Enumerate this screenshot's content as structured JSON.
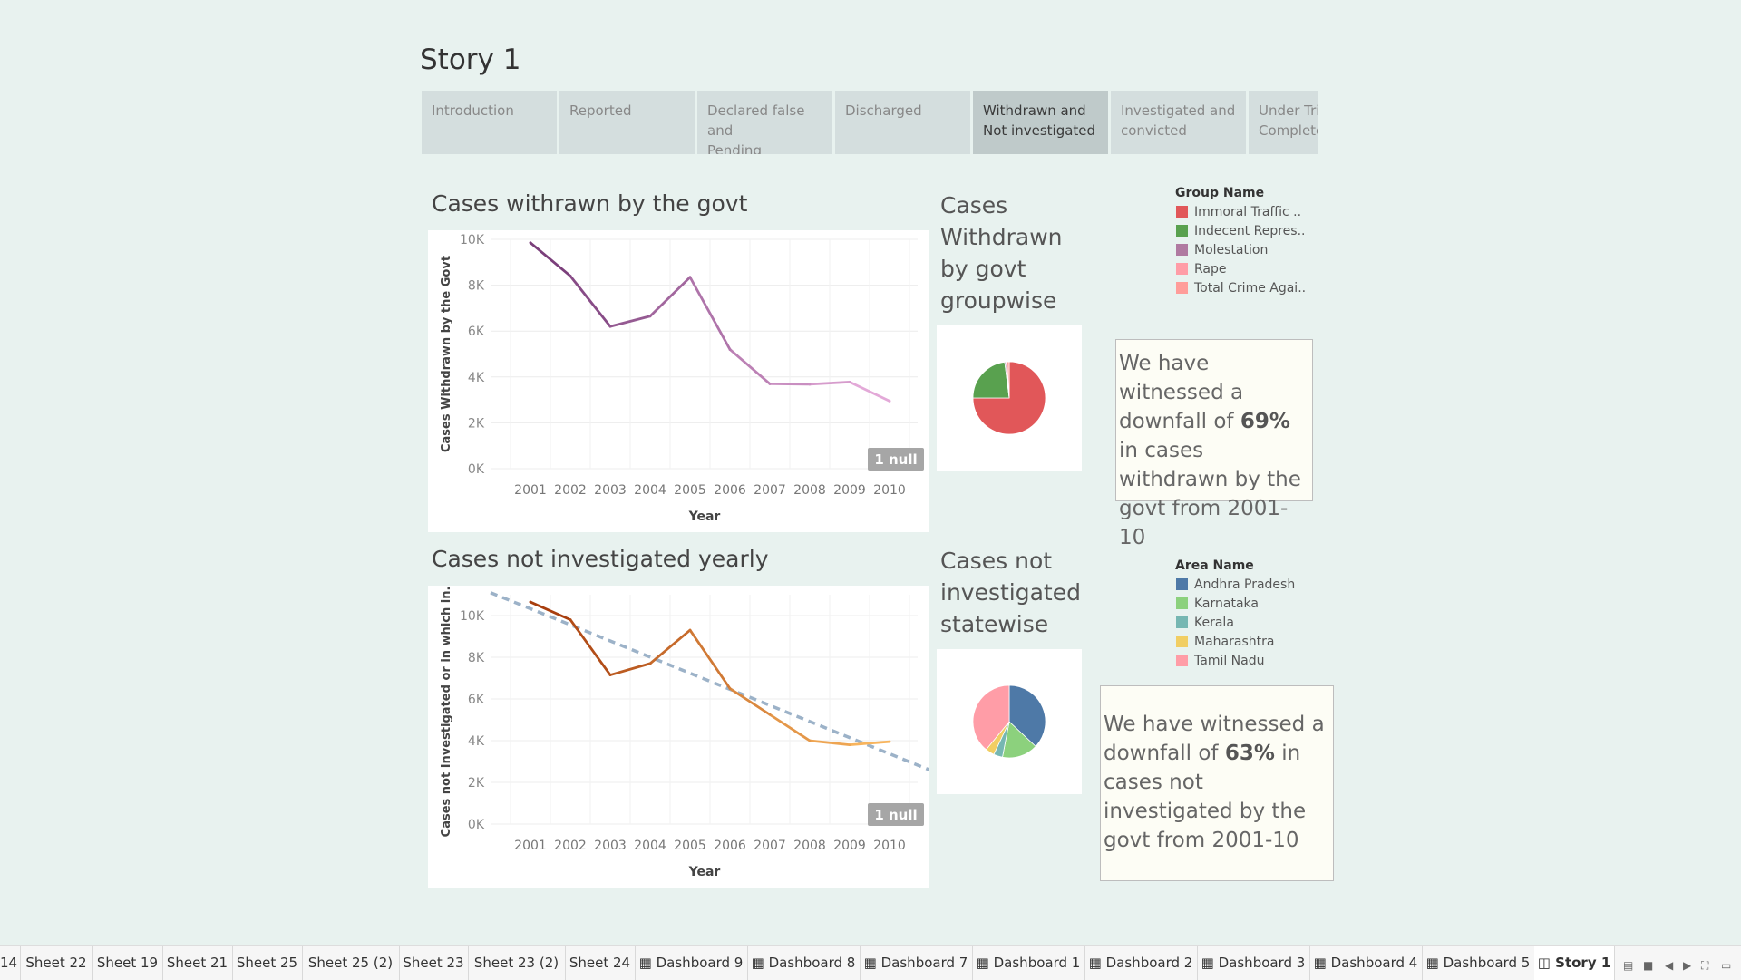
{
  "story": {
    "title": "Story 1",
    "tabs": [
      {
        "line1": "Introduction",
        "line2": ""
      },
      {
        "line1": "Reported",
        "line2": ""
      },
      {
        "line1": "Declared false and",
        "line2": "Pending"
      },
      {
        "line1": "Discharged",
        "line2": ""
      },
      {
        "line1": "Withdrawn and",
        "line2": "Not investigated"
      },
      {
        "line1": "Investigated and",
        "line2": "convicted"
      },
      {
        "line1": "Under Trial",
        "line2": "Complete"
      }
    ],
    "active_tab": 4
  },
  "chart1": {
    "title": "Cases withrawn by the govt",
    "null_badge": "1 null"
  },
  "chart2": {
    "title": "Cases not investigated yearly",
    "null_badge": "1 null"
  },
  "pie1": {
    "title_lines": [
      "Cases",
      "Withdrawn",
      "by govt",
      "groupwise"
    ],
    "legend_title": "Group Name",
    "legend": [
      {
        "label": "Immoral Traffic ..",
        "color": "#e15759"
      },
      {
        "label": "Indecent Repres..",
        "color": "#59a14f"
      },
      {
        "label": "Molestation",
        "color": "#b07aa1"
      },
      {
        "label": "Rape",
        "color": "#ff9da7"
      },
      {
        "label": "Total Crime Agai..",
        "color": "#ff9d9a"
      }
    ],
    "slices": [
      {
        "name": "Immoral Traffic ..",
        "value": 0.75,
        "color": "#e15759"
      },
      {
        "name": "Indecent Repres..",
        "value": 0.23,
        "color": "#59a14f"
      },
      {
        "name": "Molestation",
        "value": 0.006,
        "color": "#b07aa1"
      },
      {
        "name": "Rape",
        "value": 0.004,
        "color": "#ff9da7"
      },
      {
        "name": "Total Crime Agai..",
        "value": 0.01,
        "color": "#ff9d9a"
      }
    ]
  },
  "pie2": {
    "title_lines": [
      "Cases not",
      "investigated",
      "statewise"
    ],
    "legend_title": "Area Name",
    "legend": [
      {
        "label": "Andhra Pradesh",
        "color": "#4e79a7"
      },
      {
        "label": "Karnataka",
        "color": "#8cd17d"
      },
      {
        "label": "Kerala",
        "color": "#76b7b2"
      },
      {
        "label": "Maharashtra",
        "color": "#f1ce63"
      },
      {
        "label": "Tamil Nadu",
        "color": "#ff9da7"
      }
    ],
    "slices": [
      {
        "name": "Andhra Pradesh",
        "value": 0.37,
        "color": "#4e79a7"
      },
      {
        "name": "Karnataka",
        "value": 0.16,
        "color": "#8cd17d"
      },
      {
        "name": "Kerala",
        "value": 0.04,
        "color": "#76b7b2"
      },
      {
        "name": "Maharashtra",
        "value": 0.04,
        "color": "#f1ce63"
      },
      {
        "name": "Tamil Nadu",
        "value": 0.39,
        "color": "#ff9da7"
      }
    ]
  },
  "note1": {
    "pre": "We have witnessed a downfall of ",
    "pct": "69%",
    "post": " in cases withdrawn by the govt from 2001-10"
  },
  "note2": {
    "pre": "We have witnessed a downfall of ",
    "pct": "63%",
    "post": " in cases not investigated by the govt from 2001-10"
  },
  "bottom_tabs": [
    {
      "label": "14",
      "icon": ""
    },
    {
      "label": "Sheet 22",
      "icon": ""
    },
    {
      "label": "Sheet 19",
      "icon": ""
    },
    {
      "label": "Sheet 21",
      "icon": ""
    },
    {
      "label": "Sheet 25",
      "icon": ""
    },
    {
      "label": "Sheet 25 (2)",
      "icon": ""
    },
    {
      "label": "Sheet 23",
      "icon": ""
    },
    {
      "label": "Sheet 23 (2)",
      "icon": ""
    },
    {
      "label": "Sheet 24",
      "icon": ""
    },
    {
      "label": "Dashboard 9",
      "icon": "dashboard-icon"
    },
    {
      "label": "Dashboard 8",
      "icon": "dashboard-icon"
    },
    {
      "label": "Dashboard 7",
      "icon": "dashboard-icon"
    },
    {
      "label": "Dashboard 1",
      "icon": "dashboard-icon"
    },
    {
      "label": "Dashboard 2",
      "icon": "dashboard-icon"
    },
    {
      "label": "Dashboard 3",
      "icon": "dashboard-icon"
    },
    {
      "label": "Dashboard 4",
      "icon": "dashboard-icon"
    },
    {
      "label": "Dashboard 5",
      "icon": "dashboard-icon"
    },
    {
      "label": "Story 1",
      "icon": "story-icon"
    }
  ],
  "chart_data": [
    {
      "type": "line",
      "title": "Cases withrawn by the govt",
      "xlabel": "Year",
      "ylabel": "Cases Withdrawn by the Govt",
      "x": [
        "2001",
        "2002",
        "2003",
        "2004",
        "2005",
        "2006",
        "2007",
        "2008",
        "2009",
        "2010"
      ],
      "series": [
        {
          "values": [
            9850,
            8400,
            6200,
            6650,
            8350,
            5200,
            3700,
            3680,
            3780,
            2950
          ]
        }
      ],
      "ylim": [
        0,
        10000
      ],
      "yticks": [
        "0K",
        "2K",
        "4K",
        "6K",
        "8K",
        "10K"
      ],
      "color_gradient": [
        "#7b3f7b",
        "#e3a9d8"
      ],
      "grid": true
    },
    {
      "type": "line",
      "title": "Cases not investigated yearly",
      "xlabel": "Year",
      "ylabel": "Cases not Investigated or in which in..",
      "x": [
        "2001",
        "2002",
        "2003",
        "2004",
        "2005",
        "2006",
        "2007",
        "2008",
        "2009",
        "2010"
      ],
      "series": [
        {
          "values": [
            10650,
            9800,
            7150,
            7700,
            9300,
            6500,
            5250,
            4000,
            3800,
            3950
          ]
        }
      ],
      "trendline": {
        "start": [
          2000.0,
          11100
        ],
        "end": [
          2011.0,
          2600
        ]
      },
      "ylim": [
        0,
        11000
      ],
      "yticks": [
        "0K",
        "2K",
        "4K",
        "6K",
        "8K",
        "10K"
      ],
      "color_gradient": [
        "#a83e0e",
        "#f8b45c"
      ],
      "trend_color": "#9cb2c8",
      "grid": true
    }
  ]
}
